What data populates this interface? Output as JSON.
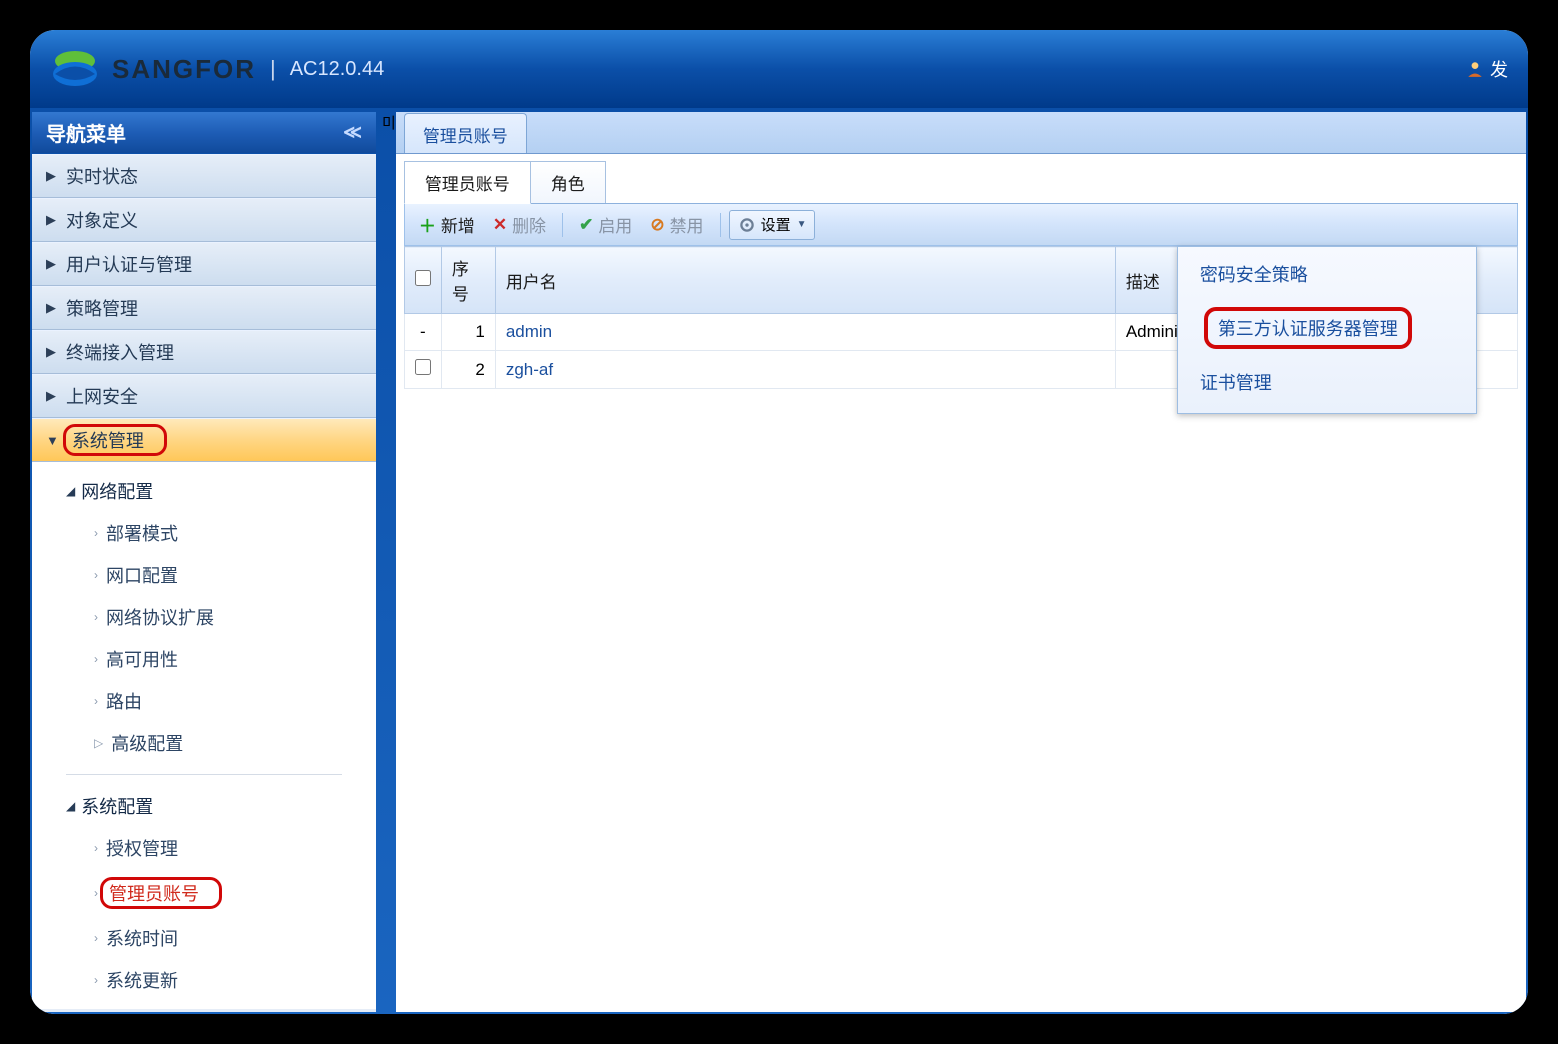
{
  "header": {
    "brand": "SANGFOR",
    "version": "AC12.0.44",
    "user_label": "发"
  },
  "sidebar": {
    "title": "导航菜单",
    "items": [
      {
        "label": "实时状态"
      },
      {
        "label": "对象定义"
      },
      {
        "label": "用户认证与管理"
      },
      {
        "label": "策略管理"
      },
      {
        "label": "终端接入管理"
      },
      {
        "label": "上网安全"
      },
      {
        "label": "系统管理",
        "expanded": true
      }
    ],
    "sys_tree": {
      "group1": {
        "head": "网络配置",
        "leaves": [
          "部署模式",
          "网口配置",
          "网络协议扩展",
          "高可用性",
          "路由",
          "高级配置"
        ]
      },
      "group2": {
        "head": "系统配置",
        "leaves": [
          "授权管理",
          "管理员账号",
          "系统时间",
          "系统更新"
        ]
      }
    }
  },
  "main": {
    "tab": "管理员账号",
    "inner_tabs": {
      "accounts": "管理员账号",
      "roles": "角色"
    },
    "toolbar": {
      "add": "新增",
      "delete": "删除",
      "enable": "启用",
      "disable": "禁用",
      "settings": "设置"
    },
    "columns": {
      "idx": "序号",
      "user": "用户名",
      "desc": "描述"
    },
    "rows": [
      {
        "idx": "1",
        "user": "admin",
        "desc": "Administrator",
        "dash": true
      },
      {
        "idx": "2",
        "user": "zgh-af",
        "desc": ""
      }
    ],
    "dropdown": {
      "password_policy": "密码安全策略",
      "thirdparty_auth": "第三方认证服务器管理",
      "cert_mgmt": "证书管理"
    }
  }
}
